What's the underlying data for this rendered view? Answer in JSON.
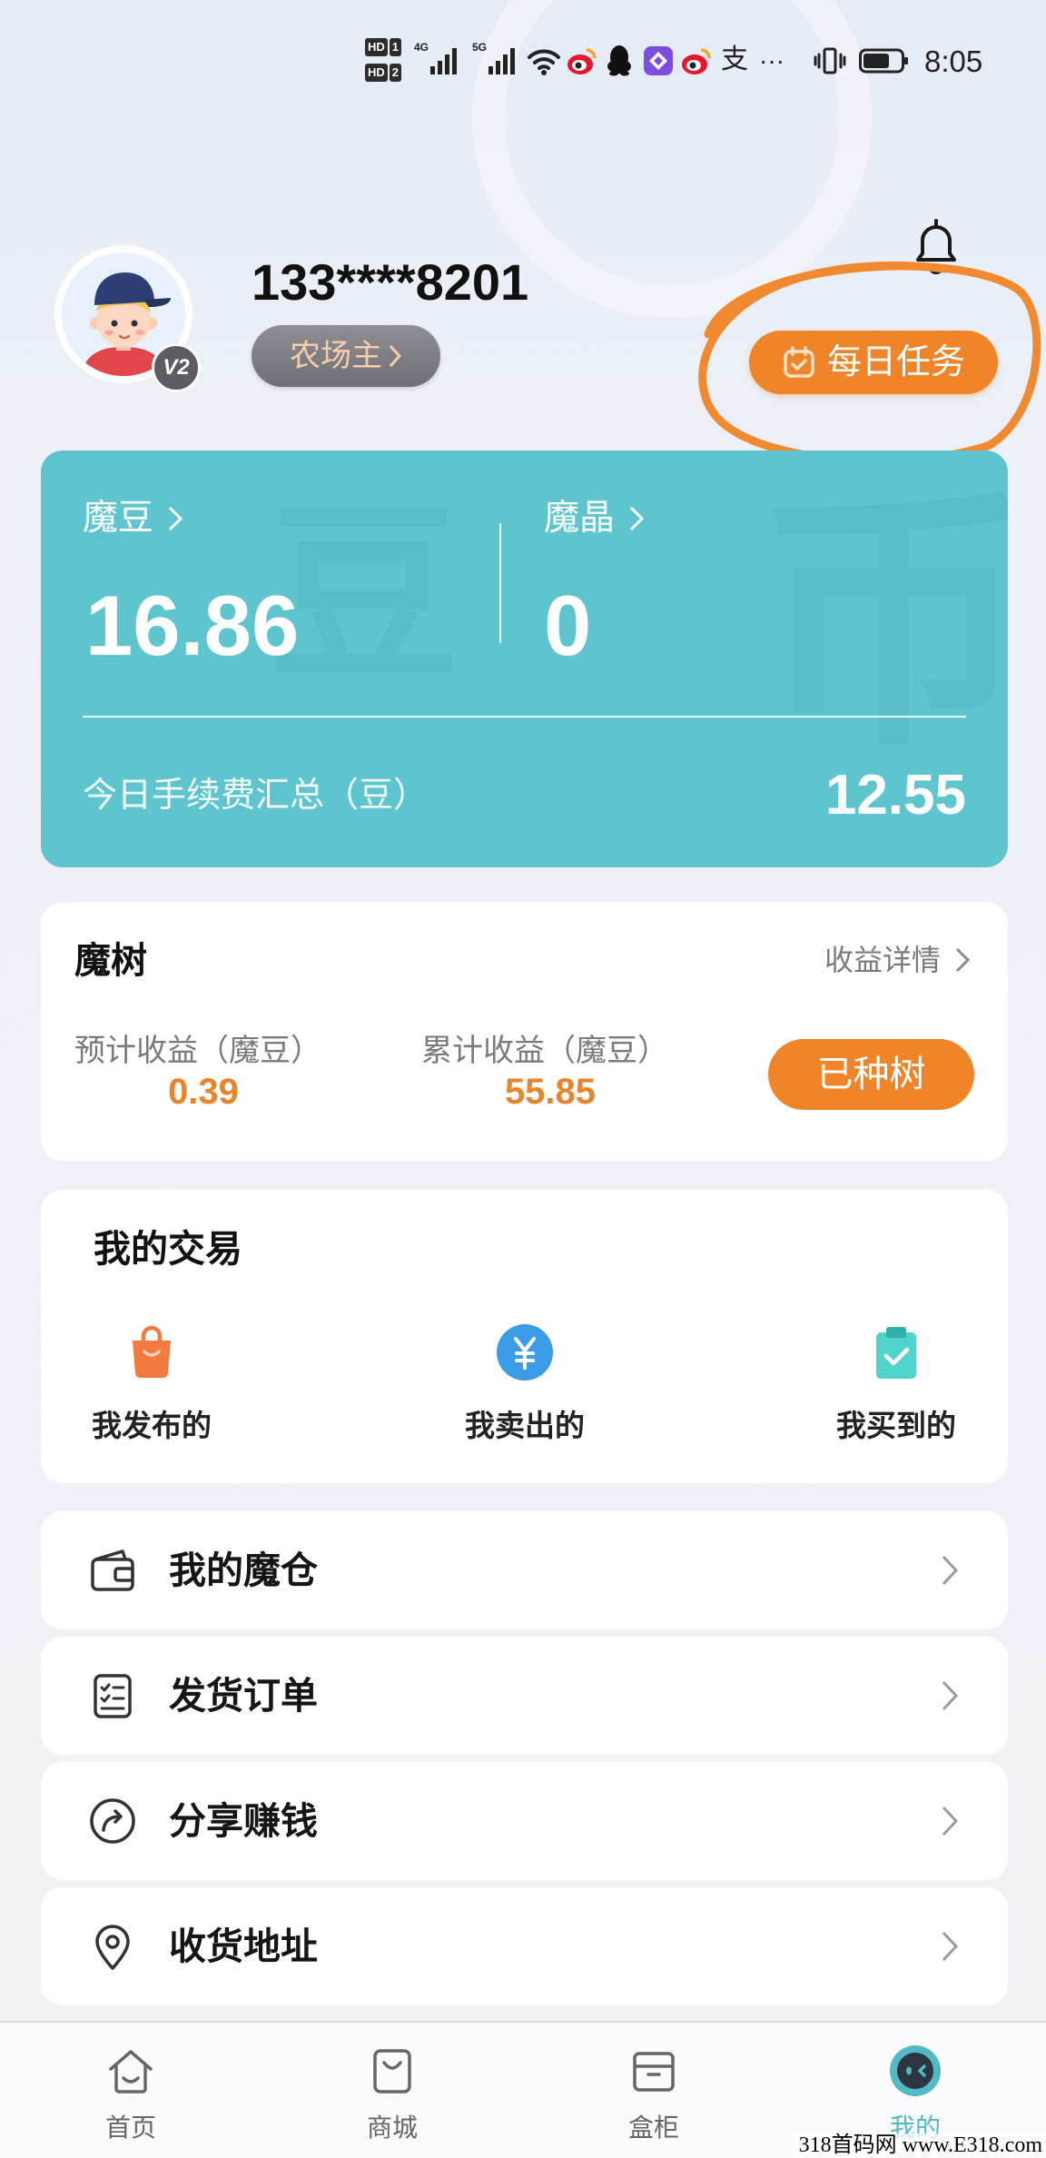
{
  "theme": {
    "teal": "#5ec5ce",
    "orange": "#ef8528",
    "value_orange": "#e5862c",
    "nav_active": "#4fb9c4",
    "annotation": "#f0892f"
  },
  "status_bar": {
    "hd_a": "HD",
    "hd_a_num": "1",
    "hd_b": "HD",
    "hd_b_num": "2",
    "net_a": "4G",
    "net_b": "5G",
    "icons": [
      "signal-icon",
      "signal-icon",
      "wifi-icon",
      "weibo-icon",
      "qq-icon",
      "app-icon",
      "weibo-icon",
      "vibrate-icon",
      "battery-icon"
    ],
    "alipay": "支",
    "more": "···",
    "battery_level": 0.7,
    "time": "8:05"
  },
  "profile": {
    "phone": "133****8201",
    "badge": "V2",
    "level": "农场主",
    "daily_task": "每日任务"
  },
  "assets": {
    "dou_label": "魔豆",
    "dou_value": "16.86",
    "jing_label": "魔晶",
    "jing_value": "0",
    "fee_label": "今日手续费汇总（豆）",
    "fee_value": "12.55",
    "watermark_left": "豆",
    "watermark_right": "币"
  },
  "tree": {
    "title": "魔树",
    "detail_link": "收益详情",
    "estimated_label": "预计收益（魔豆）",
    "estimated_value": "0.39",
    "total_label": "累计收益（魔豆）",
    "total_value": "55.85",
    "button": "已种树"
  },
  "trades": {
    "title": "我的交易",
    "items": [
      {
        "label": "我发布的",
        "icon": "shopping-bag-icon"
      },
      {
        "label": "我卖出的",
        "icon": "yen-icon"
      },
      {
        "label": "我买到的",
        "icon": "clipboard-check-icon"
      }
    ]
  },
  "menu": [
    {
      "label": "我的魔仓",
      "icon": "wallet-icon"
    },
    {
      "label": "发货订单",
      "icon": "order-list-icon"
    },
    {
      "label": "分享赚钱",
      "icon": "share-icon"
    },
    {
      "label": "收货地址",
      "icon": "location-pin-icon"
    }
  ],
  "nav": [
    {
      "label": "首页",
      "icon": "home-icon"
    },
    {
      "label": "商城",
      "icon": "shop-bag-icon"
    },
    {
      "label": "盒柜",
      "icon": "box-icon"
    },
    {
      "label": "我的",
      "icon": "profile-face-icon",
      "active": true
    }
  ],
  "site_watermark": "318首码网 www.E318.com"
}
